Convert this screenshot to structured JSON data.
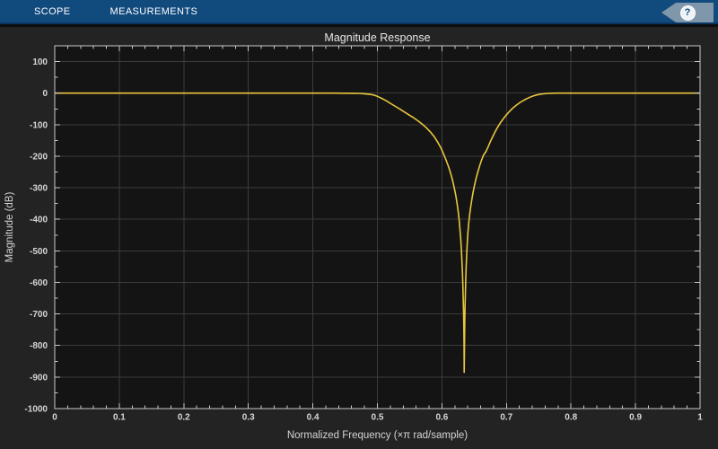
{
  "toolbar": {
    "tabs": [
      {
        "label": "SCOPE"
      },
      {
        "label": "MEASUREMENTS"
      }
    ],
    "help_label": "?"
  },
  "chart_data": {
    "type": "line",
    "title": "Magnitude Response",
    "xlabel": "Normalized Frequency (×π rad/sample)",
    "ylabel": "Magnitude (dB)",
    "xlim": [
      0,
      1
    ],
    "ylim": [
      -1000,
      150
    ],
    "xticks": [
      0,
      0.1,
      0.2,
      0.3,
      0.4,
      0.5,
      0.6,
      0.7,
      0.8,
      0.9,
      1
    ],
    "xtick_labels": [
      "0",
      "0.1",
      "0.2",
      "0.3",
      "0.4",
      "0.5",
      "0.6",
      "0.7",
      "0.8",
      "0.9",
      "1"
    ],
    "yticks": [
      100,
      0,
      -100,
      -200,
      -300,
      -400,
      -500,
      -600,
      -700,
      -800,
      -900,
      -1000
    ],
    "ytick_labels": [
      "100",
      "0",
      "-100",
      "-200",
      "-300",
      "-400",
      "-500",
      "-600",
      "-700",
      "-800",
      "-900",
      "-1000"
    ],
    "x_minor_step": 0.02,
    "y_minor_step": 50,
    "grid": true,
    "legend": null,
    "notch_center": 0.6346,
    "notch_depth_db": -885,
    "series": [
      {
        "name": "Magnitude Response",
        "points": [
          [
            0.0,
            0
          ],
          [
            0.15,
            0
          ],
          [
            0.3,
            0
          ],
          [
            0.4,
            0
          ],
          [
            0.43,
            -0.1
          ],
          [
            0.45,
            -0.25
          ],
          [
            0.463,
            -0.5
          ],
          [
            0.472,
            -1
          ],
          [
            0.48,
            -1.9
          ],
          [
            0.487,
            -3.3
          ],
          [
            0.493,
            -5.5
          ],
          [
            0.498,
            -8.6
          ],
          [
            0.503,
            -13
          ],
          [
            0.509,
            -19
          ],
          [
            0.515,
            -26
          ],
          [
            0.521,
            -33.5
          ],
          [
            0.528,
            -42
          ],
          [
            0.535,
            -51
          ],
          [
            0.542,
            -60
          ],
          [
            0.549,
            -69
          ],
          [
            0.556,
            -78
          ],
          [
            0.563,
            -88
          ],
          [
            0.57,
            -99
          ],
          [
            0.576,
            -110
          ],
          [
            0.582,
            -123
          ],
          [
            0.588,
            -138
          ],
          [
            0.593,
            -154
          ],
          [
            0.598,
            -172
          ],
          [
            0.602,
            -190
          ],
          [
            0.606,
            -210
          ],
          [
            0.61,
            -232
          ],
          [
            0.6135,
            -254
          ],
          [
            0.6165,
            -277
          ],
          [
            0.619,
            -300
          ],
          [
            0.6215,
            -325
          ],
          [
            0.6235,
            -350
          ],
          [
            0.6253,
            -377
          ],
          [
            0.6268,
            -405
          ],
          [
            0.628,
            -433
          ],
          [
            0.629,
            -460
          ],
          [
            0.63,
            -492
          ],
          [
            0.6309,
            -527
          ],
          [
            0.6317,
            -565
          ],
          [
            0.6324,
            -606
          ],
          [
            0.633,
            -650
          ],
          [
            0.6335,
            -695
          ],
          [
            0.6339,
            -741
          ],
          [
            0.6342,
            -788
          ],
          [
            0.6344,
            -830
          ],
          [
            0.63455,
            -885
          ],
          [
            0.6347,
            -860
          ],
          [
            0.6349,
            -812
          ],
          [
            0.6352,
            -762
          ],
          [
            0.6355,
            -718
          ],
          [
            0.6359,
            -672
          ],
          [
            0.6364,
            -628
          ],
          [
            0.637,
            -585
          ],
          [
            0.6377,
            -544
          ],
          [
            0.6385,
            -506
          ],
          [
            0.6394,
            -471
          ],
          [
            0.6404,
            -440
          ],
          [
            0.6416,
            -411
          ],
          [
            0.643,
            -385
          ],
          [
            0.6446,
            -360
          ],
          [
            0.6464,
            -336
          ],
          [
            0.6484,
            -313
          ],
          [
            0.6506,
            -291
          ],
          [
            0.653,
            -270
          ],
          [
            0.6556,
            -250
          ],
          [
            0.6584,
            -231
          ],
          [
            0.6614,
            -213
          ],
          [
            0.6646,
            -196
          ],
          [
            0.668,
            -186
          ],
          [
            0.6716,
            -170
          ],
          [
            0.675,
            -154
          ],
          [
            0.6784,
            -139
          ],
          [
            0.682,
            -124
          ],
          [
            0.6858,
            -110
          ],
          [
            0.69,
            -96
          ],
          [
            0.6945,
            -83
          ],
          [
            0.699,
            -71
          ],
          [
            0.704,
            -59.5
          ],
          [
            0.709,
            -49
          ],
          [
            0.7145,
            -39.5
          ],
          [
            0.72,
            -31
          ],
          [
            0.726,
            -23.5
          ],
          [
            0.732,
            -17
          ],
          [
            0.738,
            -11.7
          ],
          [
            0.744,
            -7.5
          ],
          [
            0.75,
            -4.4
          ],
          [
            0.757,
            -2.2
          ],
          [
            0.764,
            -1
          ],
          [
            0.771,
            -0.4
          ],
          [
            0.779,
            -0.1
          ],
          [
            0.79,
            0
          ],
          [
            0.85,
            0
          ],
          [
            0.92,
            0
          ],
          [
            1.0,
            0
          ]
        ]
      }
    ],
    "colors": {
      "line": "#e9c63e",
      "plot_bg": "#141414",
      "figure_bg": "#232323",
      "grid": "#3c3c3c",
      "axis": "#c8c8c8",
      "tick_label": "#d6d6d6",
      "title": "#e6e6e6",
      "toolbar_bg": "#114a7d",
      "help_chevron": "#8096ab"
    }
  }
}
